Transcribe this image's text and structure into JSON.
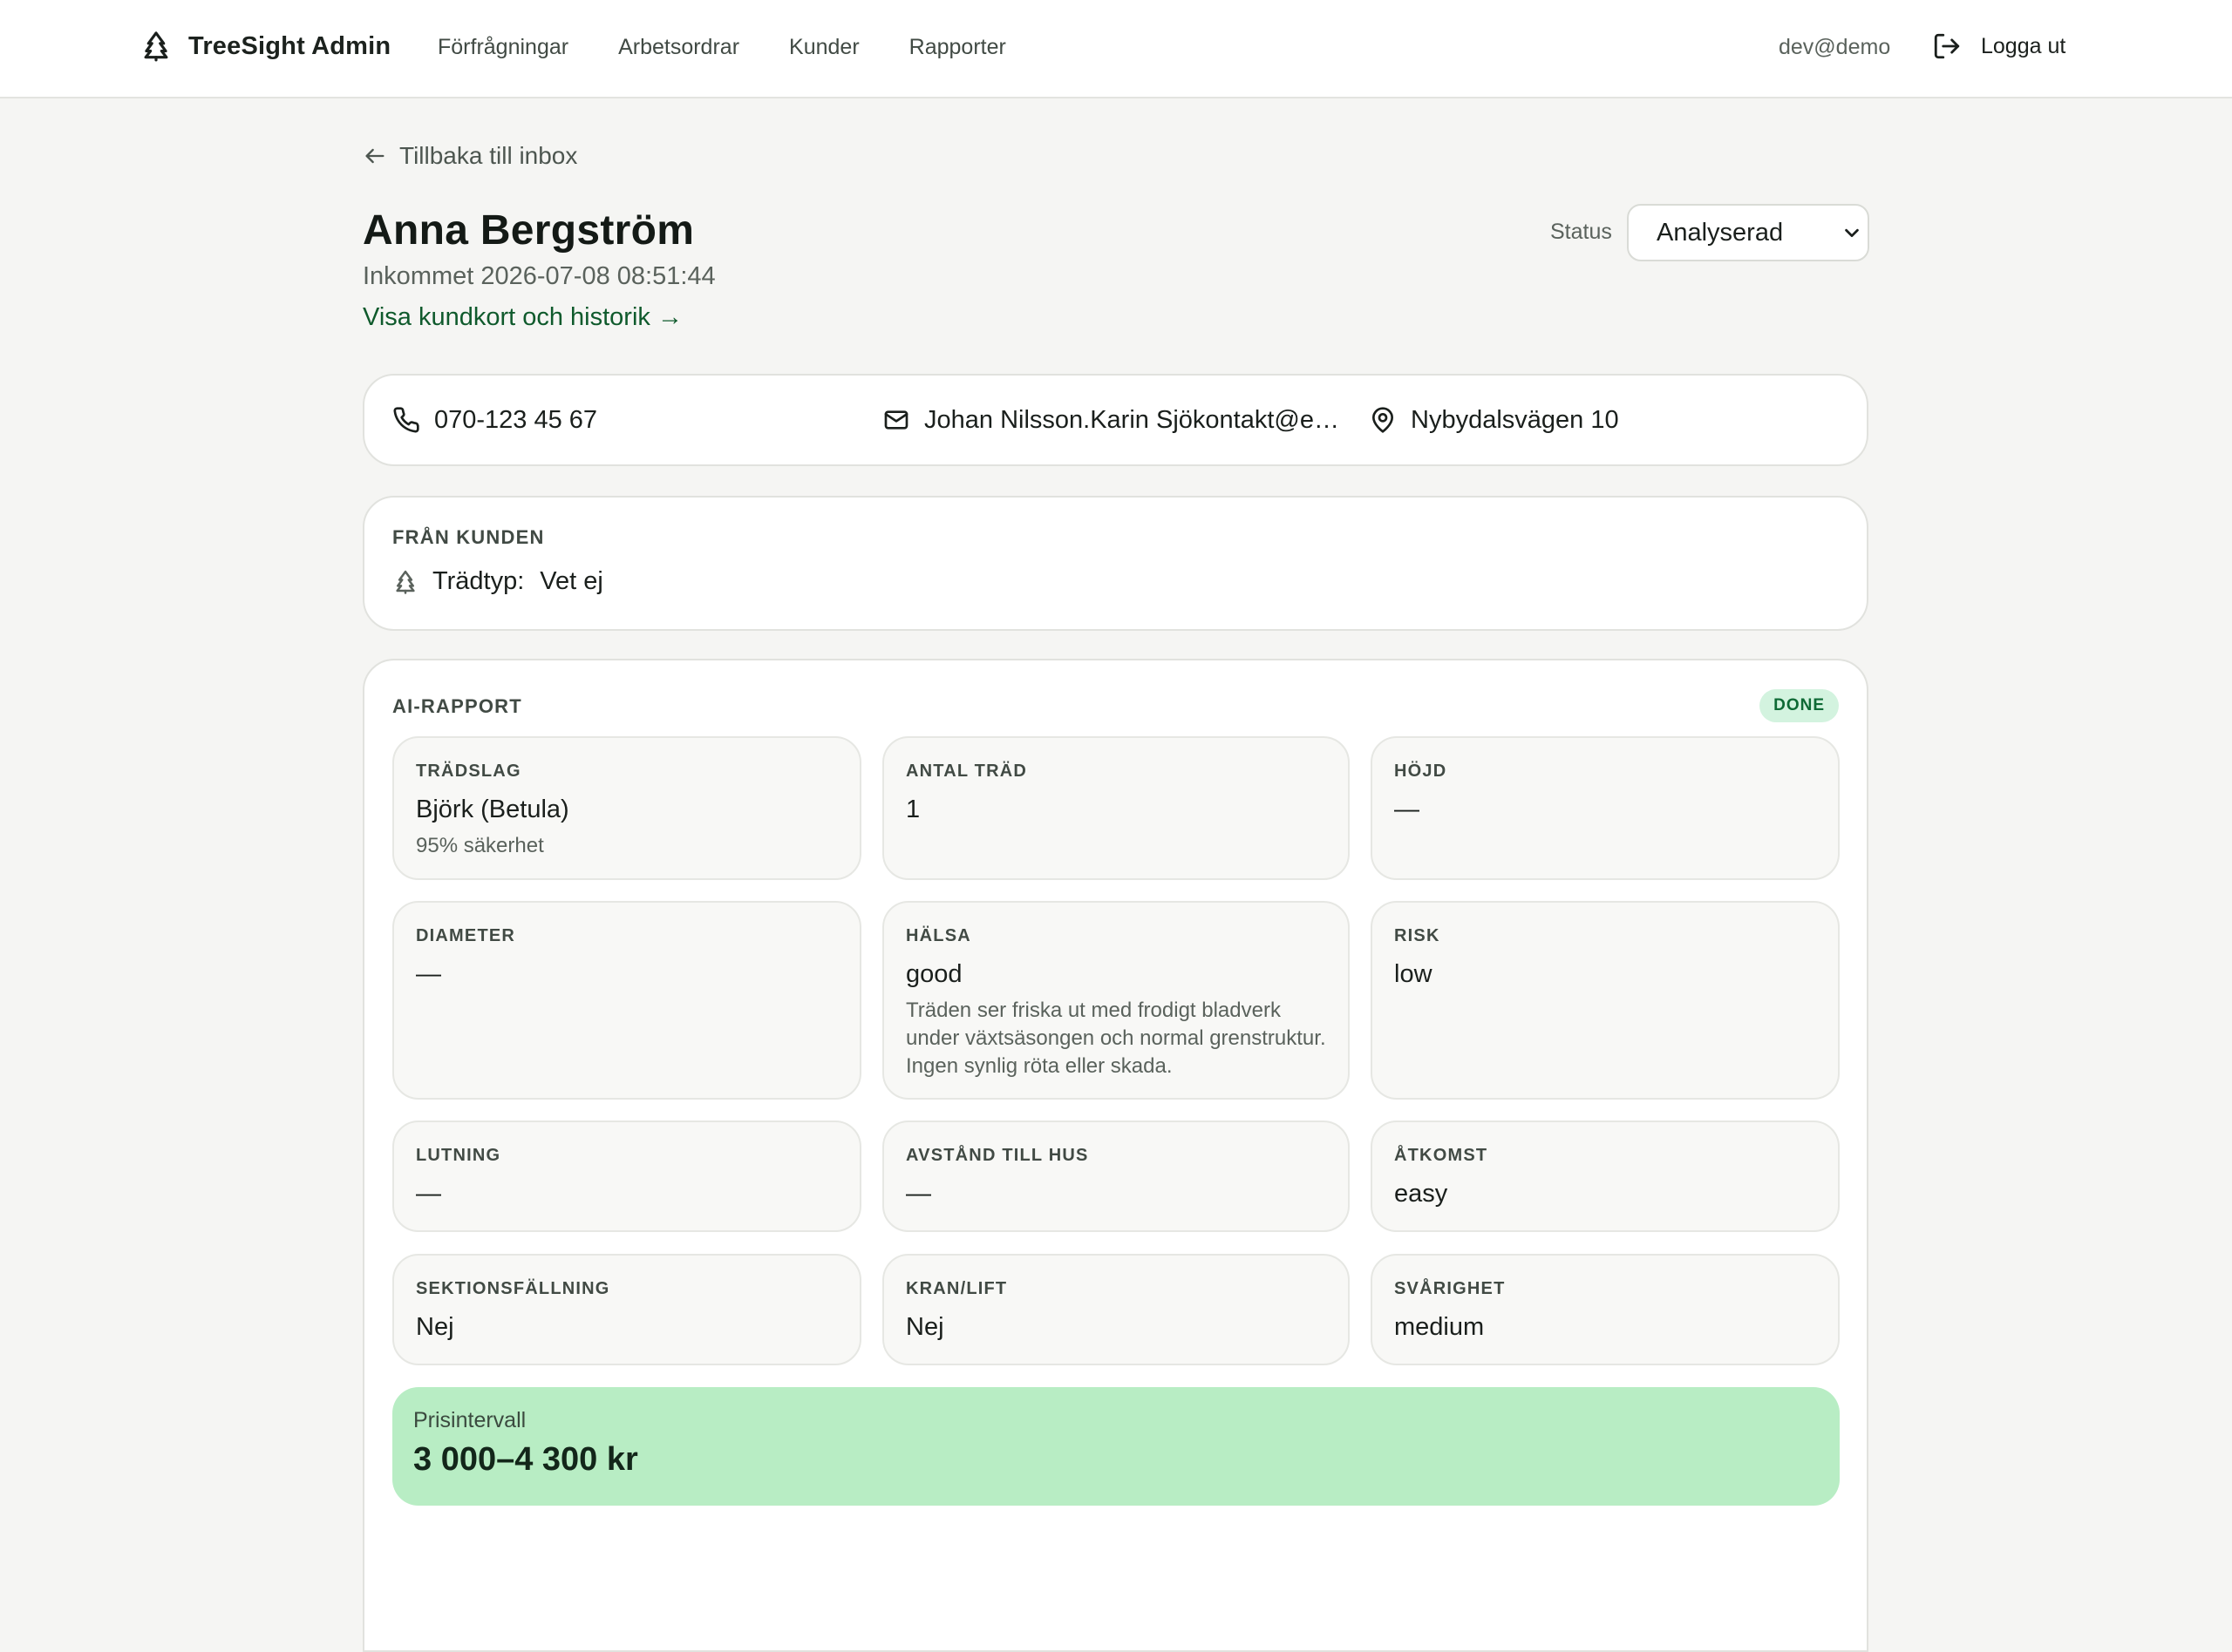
{
  "app": {
    "brand": "TreeSight Admin"
  },
  "nav": {
    "items": [
      {
        "label": "Förfrågningar"
      },
      {
        "label": "Arbetsordrar"
      },
      {
        "label": "Kunder"
      },
      {
        "label": "Rapporter"
      }
    ],
    "user_email": "dev@demo",
    "logout_label": "Logga ut"
  },
  "page": {
    "back_label": "Tillbaka till inbox",
    "title": "Anna Bergström",
    "received": "Inkommet 2026-07-08 08:51:44",
    "customer_link": "Visa kundkort och historik →",
    "status_label": "Status",
    "status_value": "Analyserad"
  },
  "contact": {
    "phone": "070-123 45 67",
    "email": "Johan Nilsson.Karin Sjökontakt@ex...",
    "address": "Nybydalsvägen 10"
  },
  "from_customer": {
    "label": "FRÅN KUNDEN",
    "tree_type_key": "Trädtyp:",
    "tree_type_value": "Vet ej"
  },
  "ai_report": {
    "label": "AI-RAPPORT",
    "badge": "DONE",
    "tiles": {
      "species": {
        "label": "TRÄDSLAG",
        "value": "Björk (Betula)",
        "sub": "95% säkerhet"
      },
      "count": {
        "label": "ANTAL TRÄD",
        "value": "1"
      },
      "height": {
        "label": "HÖJD",
        "value": "—"
      },
      "diameter": {
        "label": "DIAMETER",
        "value": "—"
      },
      "health": {
        "label": "HÄLSA",
        "value": "good",
        "sub": "Träden ser friska ut med frodigt bladverk under växtsäsongen och normal grenstruktur. Ingen synlig röta eller skada."
      },
      "risk": {
        "label": "RISK",
        "value": "low"
      },
      "lean": {
        "label": "LUTNING",
        "value": "—"
      },
      "distance": {
        "label": "AVSTÅND TILL HUS",
        "value": "—"
      },
      "access": {
        "label": "ÅTKOMST",
        "value": "easy"
      },
      "sectional": {
        "label": "SEKTIONSFÄLLNING",
        "value": "Nej"
      },
      "crane": {
        "label": "KRAN/LIFT",
        "value": "Nej"
      },
      "difficulty": {
        "label": "SVÅRIGHET",
        "value": "medium"
      }
    },
    "price_label": "Prisintervall",
    "price_value": "3 000–4 300 kr"
  },
  "colors": {
    "accent_link": "#0f5a2c",
    "badge_bg": "#d3f3df",
    "price_bg": "#b8edc4",
    "page_bg": "#f5f5f3"
  }
}
